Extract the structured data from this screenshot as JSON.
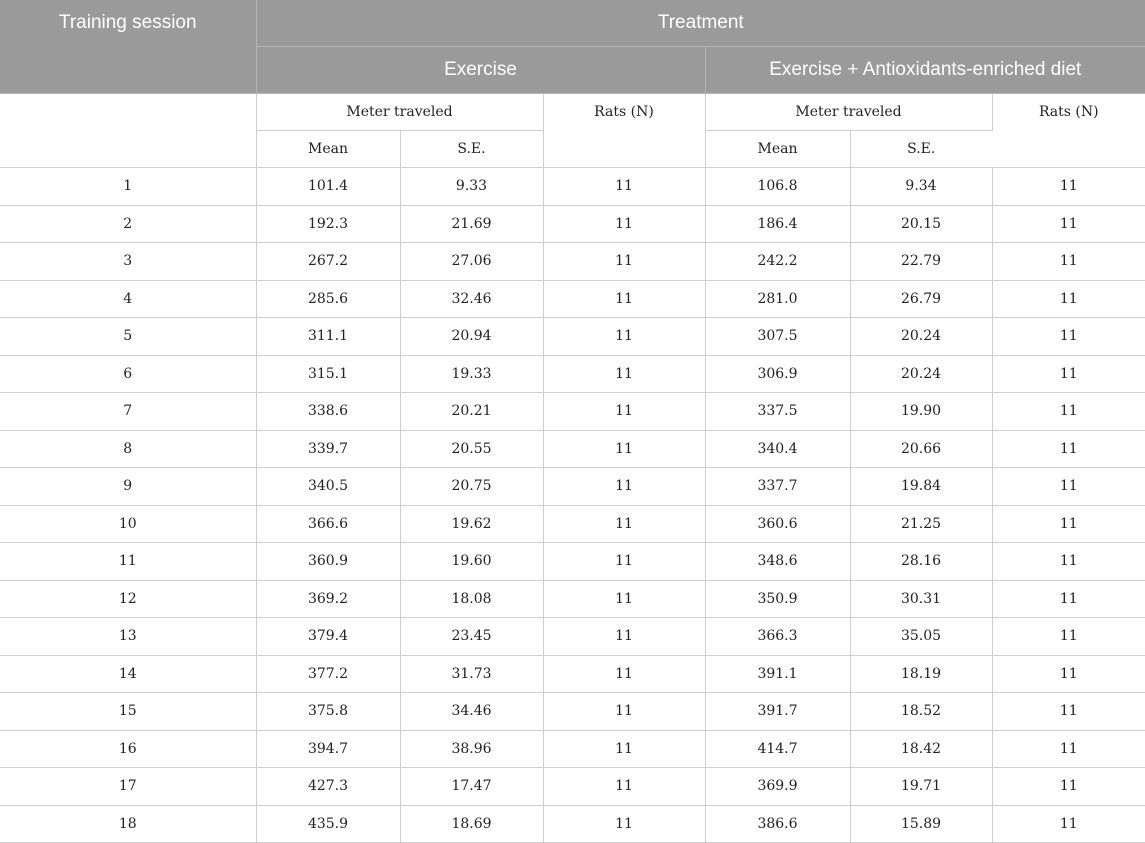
{
  "header": {
    "training_session": "Training session",
    "treatment": "Treatment",
    "group_exercise": "Exercise",
    "group_exercise_diet": "Exercise + Antioxidants-enriched diet",
    "meter_traveled": "Meter traveled",
    "rats_n": "Rats (N)",
    "mean": "Mean",
    "se": "S.E."
  },
  "rows": [
    {
      "session": "1",
      "ex_mean": "101.4",
      "ex_se": "9.33",
      "ex_n": "11",
      "ad_mean": "106.8",
      "ad_se": "9.34",
      "ad_n": "11"
    },
    {
      "session": "2",
      "ex_mean": "192.3",
      "ex_se": "21.69",
      "ex_n": "11",
      "ad_mean": "186.4",
      "ad_se": "20.15",
      "ad_n": "11"
    },
    {
      "session": "3",
      "ex_mean": "267.2",
      "ex_se": "27.06",
      "ex_n": "11",
      "ad_mean": "242.2",
      "ad_se": "22.79",
      "ad_n": "11"
    },
    {
      "session": "4",
      "ex_mean": "285.6",
      "ex_se": "32.46",
      "ex_n": "11",
      "ad_mean": "281.0",
      "ad_se": "26.79",
      "ad_n": "11"
    },
    {
      "session": "5",
      "ex_mean": "311.1",
      "ex_se": "20.94",
      "ex_n": "11",
      "ad_mean": "307.5",
      "ad_se": "20.24",
      "ad_n": "11"
    },
    {
      "session": "6",
      "ex_mean": "315.1",
      "ex_se": "19.33",
      "ex_n": "11",
      "ad_mean": "306.9",
      "ad_se": "20.24",
      "ad_n": "11"
    },
    {
      "session": "7",
      "ex_mean": "338.6",
      "ex_se": "20.21",
      "ex_n": "11",
      "ad_mean": "337.5",
      "ad_se": "19.90",
      "ad_n": "11"
    },
    {
      "session": "8",
      "ex_mean": "339.7",
      "ex_se": "20.55",
      "ex_n": "11",
      "ad_mean": "340.4",
      "ad_se": "20.66",
      "ad_n": "11"
    },
    {
      "session": "9",
      "ex_mean": "340.5",
      "ex_se": "20.75",
      "ex_n": "11",
      "ad_mean": "337.7",
      "ad_se": "19.84",
      "ad_n": "11"
    },
    {
      "session": "10",
      "ex_mean": "366.6",
      "ex_se": "19.62",
      "ex_n": "11",
      "ad_mean": "360.6",
      "ad_se": "21.25",
      "ad_n": "11"
    },
    {
      "session": "11",
      "ex_mean": "360.9",
      "ex_se": "19.60",
      "ex_n": "11",
      "ad_mean": "348.6",
      "ad_se": "28.16",
      "ad_n": "11"
    },
    {
      "session": "12",
      "ex_mean": "369.2",
      "ex_se": "18.08",
      "ex_n": "11",
      "ad_mean": "350.9",
      "ad_se": "30.31",
      "ad_n": "11"
    },
    {
      "session": "13",
      "ex_mean": "379.4",
      "ex_se": "23.45",
      "ex_n": "11",
      "ad_mean": "366.3",
      "ad_se": "35.05",
      "ad_n": "11"
    },
    {
      "session": "14",
      "ex_mean": "377.2",
      "ex_se": "31.73",
      "ex_n": "11",
      "ad_mean": "391.1",
      "ad_se": "18.19",
      "ad_n": "11"
    },
    {
      "session": "15",
      "ex_mean": "375.8",
      "ex_se": "34.46",
      "ex_n": "11",
      "ad_mean": "391.7",
      "ad_se": "18.52",
      "ad_n": "11"
    },
    {
      "session": "16",
      "ex_mean": "394.7",
      "ex_se": "38.96",
      "ex_n": "11",
      "ad_mean": "414.7",
      "ad_se": "18.42",
      "ad_n": "11"
    },
    {
      "session": "17",
      "ex_mean": "427.3",
      "ex_se": "17.47",
      "ex_n": "11",
      "ad_mean": "369.9",
      "ad_se": "19.71",
      "ad_n": "11"
    },
    {
      "session": "18",
      "ex_mean": "435.9",
      "ex_se": "18.69",
      "ex_n": "11",
      "ad_mean": "386.6",
      "ad_se": "15.89",
      "ad_n": "11"
    }
  ]
}
